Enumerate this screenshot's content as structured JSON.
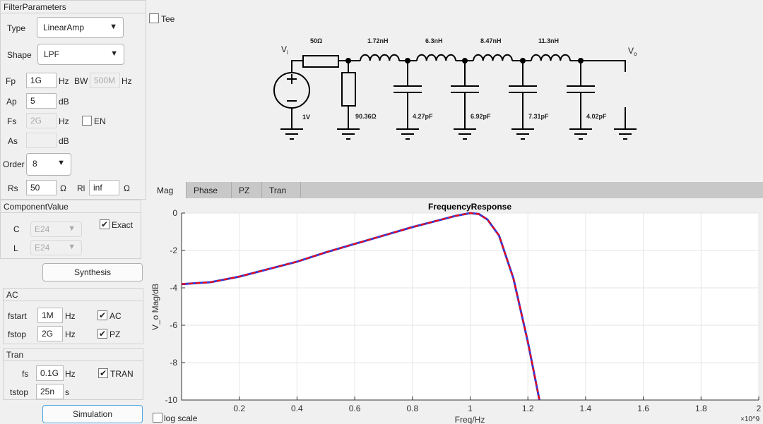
{
  "filter_parameters": {
    "title": "FilterParameters",
    "type_label": "Type",
    "type_value": "LinearAmp",
    "shape_label": "Shape",
    "shape_value": "LPF",
    "fp_label": "Fp",
    "fp_value": "1G",
    "fp_unit": "Hz",
    "bw_label": "BW",
    "bw_value": "500M",
    "bw_unit": "Hz",
    "ap_label": "Ap",
    "ap_value": "5",
    "ap_unit": "dB",
    "fs_label": "Fs",
    "fs_value": "2G",
    "fs_unit": "Hz",
    "en_label": "EN",
    "en_checked": false,
    "as_label": "As",
    "as_value": "",
    "as_unit": "dB",
    "order_label": "Order",
    "order_value": "8",
    "rs_label": "Rs",
    "rs_value": "50",
    "rs_unit": "Ω",
    "rl_label": "Rl",
    "rl_value": "inf",
    "rl_unit": "Ω"
  },
  "component_value": {
    "title": "ComponentValue",
    "c_label": "C",
    "c_value": "E24",
    "l_label": "L",
    "l_value": "E24",
    "exact_label": "Exact",
    "exact_checked": true
  },
  "synthesis_label": "Synthesis",
  "ac": {
    "title": "AC",
    "fstart_label": "fstart",
    "fstart_value": "1M",
    "fstart_unit": "Hz",
    "fstop_label": "fstop",
    "fstop_value": "2G",
    "fstop_unit": "Hz",
    "ac_label": "AC",
    "pz_label": "PZ"
  },
  "tran": {
    "title": "Tran",
    "fs_label": "fs",
    "fs_value": "0.1G",
    "fs_unit": "Hz",
    "tran_label": "TRAN",
    "tstop_label": "tstop",
    "tstop_value": "25n",
    "tstop_unit": "s"
  },
  "simulation_label": "Simulation",
  "tee_label": "Tee",
  "tee_checked": false,
  "schematic": {
    "vin": "V",
    "vin_sub": "i",
    "vout": "V",
    "vout_sub": "o",
    "source": "1V",
    "rs": "50Ω",
    "rshunt": "90.36Ω",
    "inductors": [
      "1.72nH",
      "6.3nH",
      "8.47nH",
      "11.3nH"
    ],
    "capacitors": [
      "4.27pF",
      "6.92pF",
      "7.31pF",
      "4.02pF"
    ]
  },
  "tabs": [
    "Mag",
    "Phase",
    "PZ",
    "Tran"
  ],
  "active_tab": "Mag",
  "log_scale_label": "log scale",
  "chart_data": {
    "type": "line",
    "title": "FrequencyResponse",
    "xlabel": "Freq/Hz",
    "ylabel": "V_o Mag/dB",
    "x_multiplier": "×10^9",
    "xlim": [
      0,
      2
    ],
    "ylim": [
      -10,
      0
    ],
    "grid": true,
    "xticks": [
      "0.2",
      "0.4",
      "0.6",
      "0.8",
      "1",
      "1.2",
      "1.4",
      "1.6",
      "1.8",
      "2"
    ],
    "yticks": [
      "0",
      "-2",
      "-4",
      "-6",
      "-8",
      "-10"
    ],
    "series": [
      {
        "color": "#3a3ad0",
        "x": [
          0,
          0.1,
          0.2,
          0.3,
          0.4,
          0.5,
          0.6,
          0.7,
          0.8,
          0.9,
          0.95,
          1.0,
          1.03,
          1.06,
          1.1,
          1.15,
          1.2,
          1.24
        ],
        "y": [
          -3.8,
          -3.7,
          -3.4,
          -3.0,
          -2.6,
          -2.1,
          -1.65,
          -1.2,
          -0.75,
          -0.35,
          -0.15,
          0,
          -0.05,
          -0.35,
          -1.2,
          -3.5,
          -6.9,
          -10
        ]
      },
      {
        "color": "#ff0000",
        "x": [
          0,
          0.1,
          0.2,
          0.3,
          0.4,
          0.5,
          0.6,
          0.7,
          0.8,
          0.9,
          0.95,
          1.0,
          1.03,
          1.06,
          1.1,
          1.15,
          1.2,
          1.24
        ],
        "y": [
          -3.8,
          -3.7,
          -3.4,
          -3.0,
          -2.6,
          -2.1,
          -1.65,
          -1.2,
          -0.75,
          -0.35,
          -0.15,
          0,
          -0.05,
          -0.35,
          -1.2,
          -3.5,
          -6.9,
          -10
        ]
      }
    ]
  }
}
